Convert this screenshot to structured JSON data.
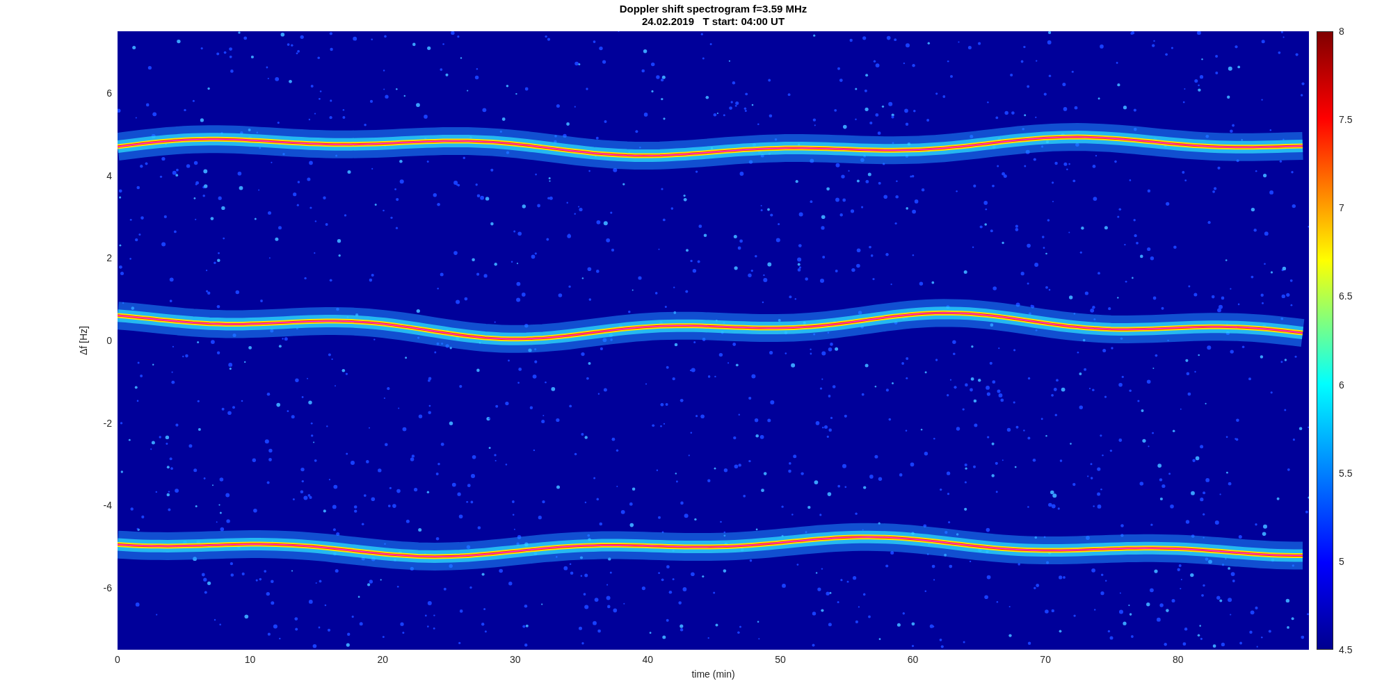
{
  "figure": {
    "title": "Doppler shift spectrogram f=3.59 MHz",
    "subtitle": "24.02.2019   T start: 04:00 UT",
    "xlabel": "time (min)",
    "ylabel": "Δf [Hz]",
    "xticks": [
      "0",
      "10",
      "20",
      "30",
      "40",
      "50",
      "60",
      "70",
      "80"
    ],
    "yticks": [
      "6",
      "4",
      "2",
      "0",
      "-2",
      "-4",
      "-6"
    ],
    "colorbar_ticks": [
      "8",
      "7.5",
      "7",
      "6.5",
      "6",
      "5.5",
      "5",
      "4.5"
    ]
  }
}
